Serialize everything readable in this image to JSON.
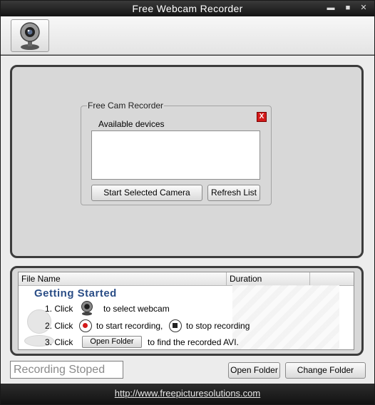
{
  "window": {
    "title": "Free Webcam Recorder",
    "minimize_label": "▬",
    "maximize_label": "■",
    "close_label": "✕"
  },
  "toolbar": {
    "webcam_button_icon": "webcam-icon"
  },
  "recorder_group": {
    "title": "Free Cam Recorder",
    "close_label": "X",
    "devices_label": "Available devices",
    "start_button": "Start Selected Camera",
    "refresh_button": "Refresh List"
  },
  "file_list": {
    "columns": [
      "File Name",
      "Duration"
    ]
  },
  "getting_started": {
    "title": "Getting  Started",
    "step1_pre": "1. Click",
    "step1_post": "to select webcam",
    "step2_pre": "2. Click",
    "step2_mid": "to start recording,",
    "step2_post": "to stop recording",
    "step3_pre": "3. Click",
    "step3_button": "Open Folder",
    "step3_post": "to find the recorded AVI."
  },
  "status": {
    "text": "Recording Stoped"
  },
  "actions": {
    "open_folder": "Open Folder",
    "change_folder": "Change Folder"
  },
  "footer": {
    "link": "http://www.freepicturesolutions.com"
  },
  "colors": {
    "accent_title": "#2a4d86",
    "record_red": "#d41a1a"
  }
}
